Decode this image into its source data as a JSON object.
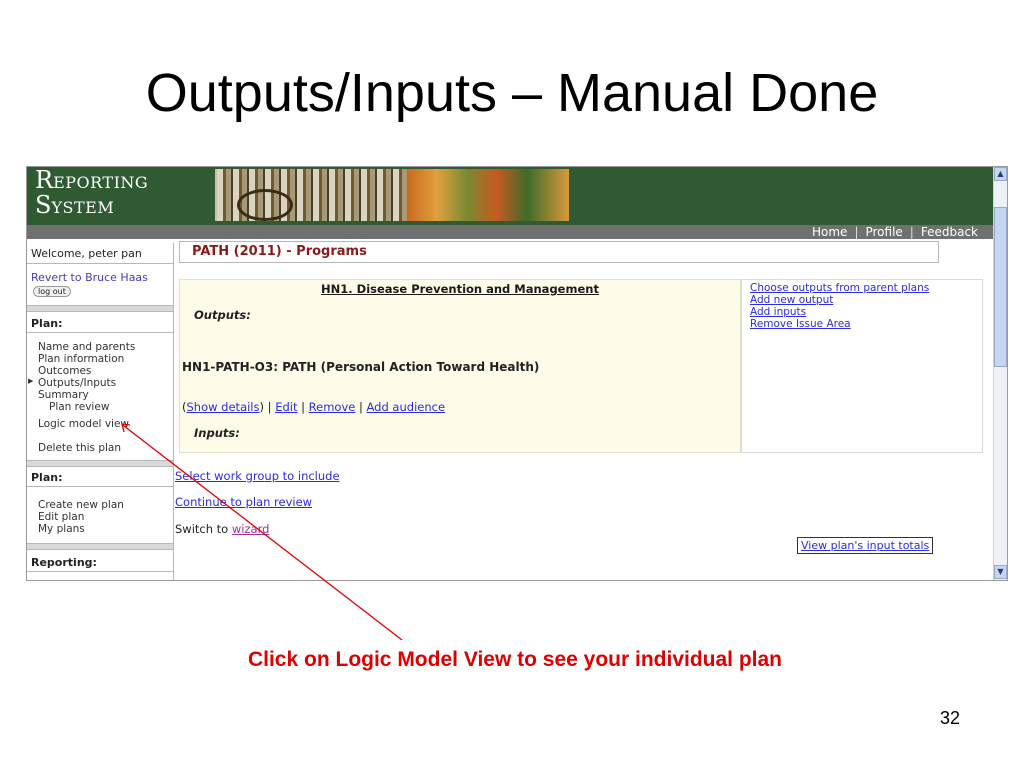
{
  "slide": {
    "title": "Outputs/Inputs – Manual Done",
    "caption": "Click on Logic Model View to see your individual plan",
    "page_number": "32",
    "accent_color": "#e00000"
  },
  "app": {
    "logo_line1_cap": "R",
    "logo_line1_rest": "EPORTING",
    "logo_line2_cap": "S",
    "logo_line2_rest": "YSTEM",
    "banner_color": "#2f5a32",
    "nav": [
      "Home",
      "Profile",
      "Feedback"
    ]
  },
  "sidebar": {
    "welcome": "Welcome, peter pan",
    "revert": "Revert to Bruce Haas",
    "logout": "log out",
    "plan_heading_1": "Plan:",
    "plan_items": [
      "Name and parents",
      "Plan information",
      "Outcomes",
      "Outputs/Inputs",
      "Summary",
      "Plan review",
      "Logic model view",
      "Delete this plan"
    ],
    "plan_heading_2": "Plan:",
    "plan2_items": [
      "Create new plan",
      "Edit plan",
      "My plans"
    ],
    "reporting_heading": "Reporting:"
  },
  "content": {
    "header": "PATH (2011) - Programs",
    "issue_title": "HN1. Disease Prevention and Management",
    "outputs_label": "Outputs:",
    "output_code": "HN1-PATH-O3: PATH (Personal Action Toward Health)",
    "actions": {
      "open": "(",
      "show_details": "Show details",
      "close": ")",
      "sep": " | ",
      "edit": "Edit",
      "remove": "Remove",
      "add_audience": "Add audience"
    },
    "inputs_label": "Inputs:",
    "side_links": [
      "Choose outputs from parent plans",
      "Add new output",
      "Add inputs",
      "Remove Issue Area"
    ],
    "select_work_group": "Select work group to include",
    "continue": "Continue to plan review",
    "switch_prefix": "Switch to ",
    "switch_link": "wizard",
    "input_totals": "View plan's input totals"
  }
}
